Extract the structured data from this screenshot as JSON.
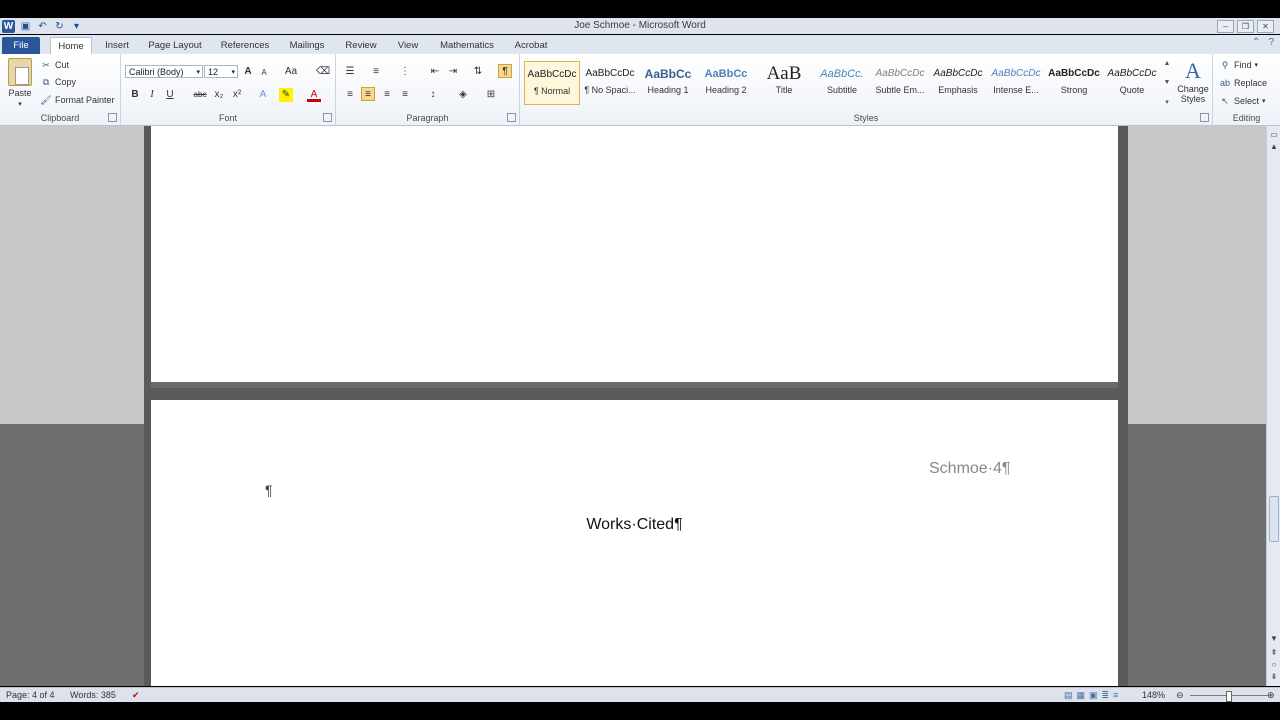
{
  "window": {
    "title": "Joe Schmoe - Microsoft Word"
  },
  "tabs": [
    "File",
    "Home",
    "Insert",
    "Page Layout",
    "References",
    "Mailings",
    "Review",
    "View",
    "Mathematics",
    "Acrobat"
  ],
  "clipboard": {
    "paste": "Paste",
    "cut": "Cut",
    "copy": "Copy",
    "format_painter": "Format Painter",
    "label": "Clipboard"
  },
  "font": {
    "family": "Calibri (Body)",
    "size": "12",
    "label": "Font",
    "bold": "B",
    "italic": "I",
    "underline": "U",
    "strike": "abc",
    "subscript": "x₂",
    "superscript": "x²",
    "grow": "A",
    "shrink": "A",
    "case": "Aa"
  },
  "paragraph": {
    "label": "Paragraph",
    "pilcrow": "¶"
  },
  "styles": {
    "label": "Styles",
    "items": [
      {
        "preview": "AaBbCcDc",
        "name": "¶ Normal"
      },
      {
        "preview": "AaBbCcDc",
        "name": "¶ No Spaci..."
      },
      {
        "preview": "AaBbCc",
        "name": "Heading 1"
      },
      {
        "preview": "AaBbCc",
        "name": "Heading 2"
      },
      {
        "preview": "AaB",
        "name": "Title"
      },
      {
        "preview": "AaBbCc.",
        "name": "Subtitle"
      },
      {
        "preview": "AaBbCcDc",
        "name": "Subtle Em..."
      },
      {
        "preview": "AaBbCcDc",
        "name": "Emphasis"
      },
      {
        "preview": "AaBbCcDc",
        "name": "Intense E..."
      },
      {
        "preview": "AaBbCcDc",
        "name": "Strong"
      },
      {
        "preview": "AaBbCcDc",
        "name": "Quote"
      }
    ],
    "change_styles": "Change Styles"
  },
  "editing": {
    "find": "Find",
    "replace": "Replace",
    "select": "Select",
    "label": "Editing"
  },
  "document": {
    "header": "Schmoe·4¶",
    "empty_paragraph": "¶",
    "heading": "Works·Cited¶"
  },
  "status": {
    "page": "Page: 4 of 4",
    "words": "Words: 385",
    "zoom": "148%"
  },
  "colors": {
    "file_tab": "#2a5699",
    "doc_bg_light": "#c8c8c8",
    "doc_bg_dark": "#6e6e6e"
  }
}
